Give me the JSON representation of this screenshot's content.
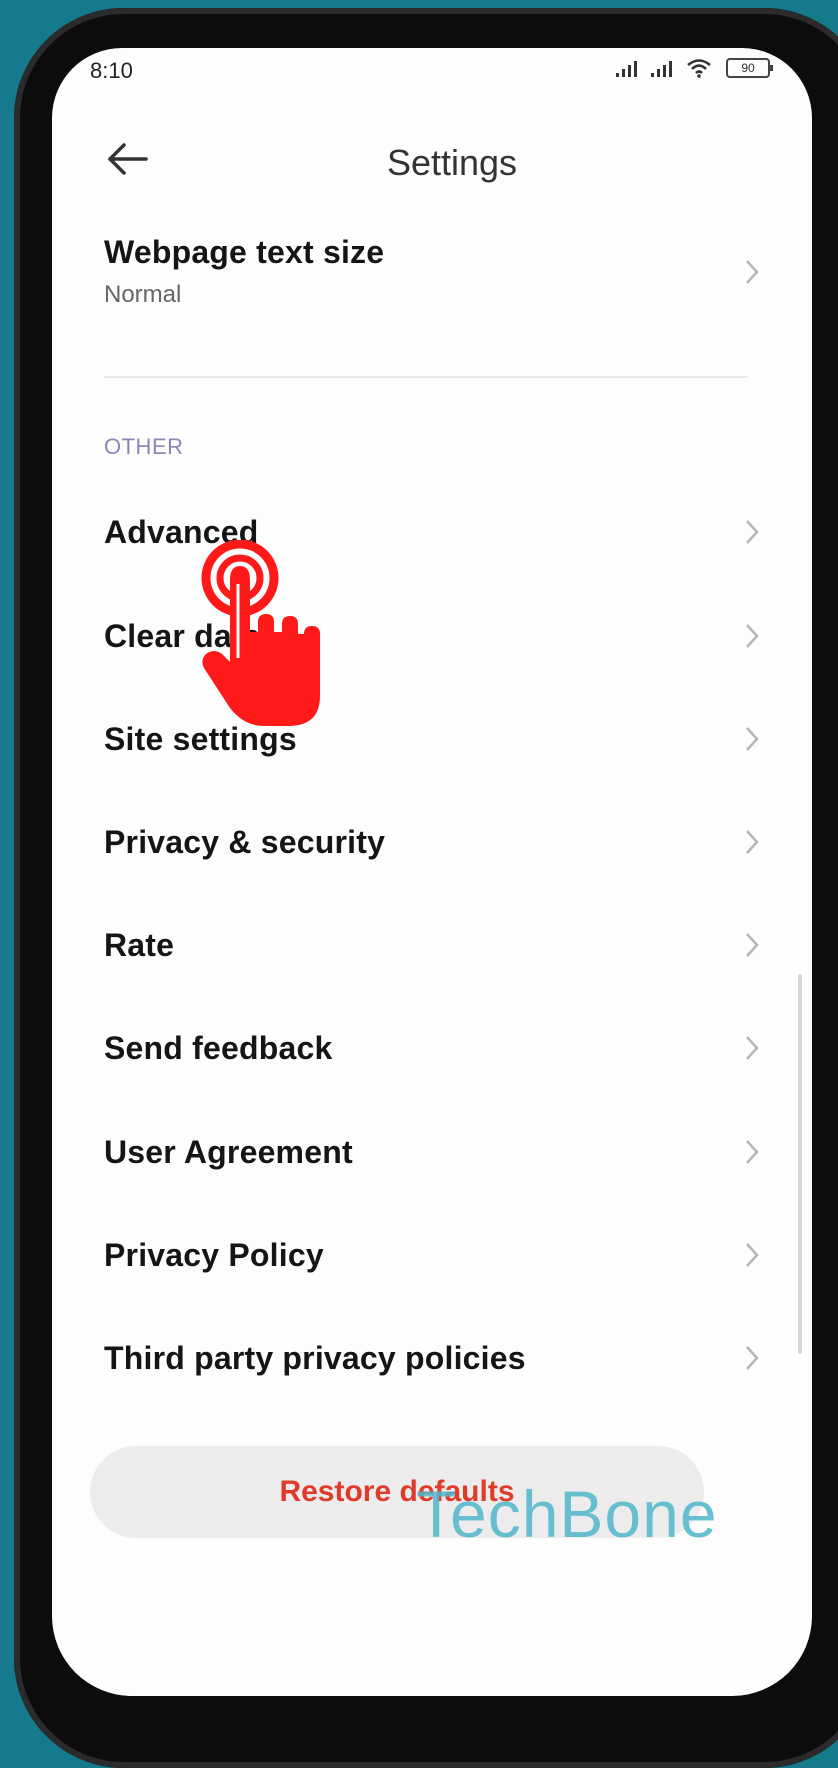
{
  "status_bar": {
    "time": "8:10",
    "battery": "90",
    "icons": [
      "signal-icon",
      "signal-icon",
      "wifi-icon",
      "battery-icon"
    ]
  },
  "header": {
    "title": "Settings",
    "back_icon": "back-arrow-icon"
  },
  "webpage_text_size": {
    "label": "Webpage text size",
    "value": "Normal"
  },
  "section_other": {
    "title": "OTHER",
    "color": "#8c86b8"
  },
  "items": [
    {
      "label": "Advanced"
    },
    {
      "label": "Clear data"
    },
    {
      "label": "Site settings"
    },
    {
      "label": "Privacy & security"
    },
    {
      "label": "Rate"
    },
    {
      "label": "Send feedback"
    },
    {
      "label": "User Agreement"
    },
    {
      "label": "Privacy Policy"
    },
    {
      "label": "Third party privacy policies"
    }
  ],
  "restore_button": {
    "label": "Restore defaults",
    "color": "#e03a2b"
  },
  "watermark": "TechBone",
  "overlay": {
    "tap_icon": "hand-tap-icon",
    "color": "#ff1a1a"
  },
  "colors": {
    "background": "#157a8c",
    "screen": "#fdfdfd"
  }
}
